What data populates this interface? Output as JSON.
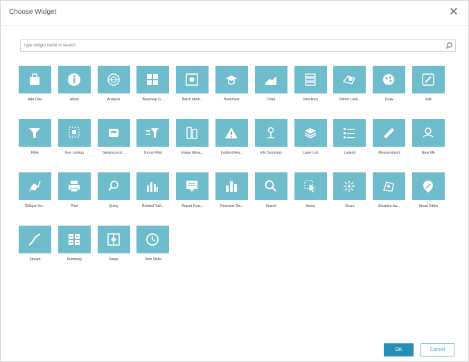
{
  "dialog": {
    "title": "Choose Widget",
    "close_glyph": "✕",
    "search_placeholder": "Type widget name to search",
    "ok_label": "OK",
    "cancel_label": "Cancel",
    "tile_color": "#6fbccc",
    "ok_color": "#2a8eb4"
  },
  "widgets": [
    {
      "label": "Add Data",
      "icon": "add-data-icon"
    },
    {
      "label": "About",
      "icon": "info-icon"
    },
    {
      "label": "Analysis",
      "icon": "analysis-icon"
    },
    {
      "label": "Basemap G...",
      "icon": "basemap-gallery-icon"
    },
    {
      "label": "Batch Attrib...",
      "icon": "batch-attribute-icon"
    },
    {
      "label": "Bookmark",
      "icon": "bookmark-icon"
    },
    {
      "label": "Chart",
      "icon": "chart-icon"
    },
    {
      "label": "Directions",
      "icon": "directions-icon"
    },
    {
      "label": "District Look...",
      "icon": "district-lookup-icon"
    },
    {
      "label": "Draw",
      "icon": "draw-icon"
    },
    {
      "label": "Edit",
      "icon": "edit-icon"
    },
    {
      "label": "Filter",
      "icon": "filter-icon"
    },
    {
      "label": "Geo Lookup",
      "icon": "geo-lookup-icon"
    },
    {
      "label": "Geoprocessi...",
      "icon": "geoprocessing-icon"
    },
    {
      "label": "Group Filter",
      "icon": "group-filter-icon"
    },
    {
      "label": "Image Meas...",
      "icon": "image-measurement-icon"
    },
    {
      "label": "Incident Ana...",
      "icon": "incident-analysis-icon"
    },
    {
      "label": "Info Summary",
      "icon": "info-summary-icon"
    },
    {
      "label": "Layer List",
      "icon": "layer-list-icon"
    },
    {
      "label": "Legend",
      "icon": "legend-icon"
    },
    {
      "label": "Measurement",
      "icon": "measurement-icon"
    },
    {
      "label": "Near Me",
      "icon": "near-me-icon"
    },
    {
      "label": "Oblique Vie...",
      "icon": "oblique-viewer-icon"
    },
    {
      "label": "Print",
      "icon": "print-icon"
    },
    {
      "label": "Query",
      "icon": "query-icon"
    },
    {
      "label": "Related Tabl...",
      "icon": "related-table-icon"
    },
    {
      "label": "Report Feat...",
      "icon": "report-feature-icon"
    },
    {
      "label": "Reviewer Da...",
      "icon": "reviewer-dashboard-icon"
    },
    {
      "label": "Search",
      "icon": "search-icon"
    },
    {
      "label": "Select",
      "icon": "select-icon"
    },
    {
      "label": "Share",
      "icon": "share-icon"
    },
    {
      "label": "Situation Aw...",
      "icon": "situation-awareness-icon"
    },
    {
      "label": "Smart Editor",
      "icon": "smart-editor-icon"
    },
    {
      "label": "Stream",
      "icon": "stream-icon"
    },
    {
      "label": "Summary",
      "icon": "summary-icon"
    },
    {
      "label": "Swipe",
      "icon": "swipe-icon"
    },
    {
      "label": "Time Slider",
      "icon": "time-slider-icon"
    }
  ]
}
